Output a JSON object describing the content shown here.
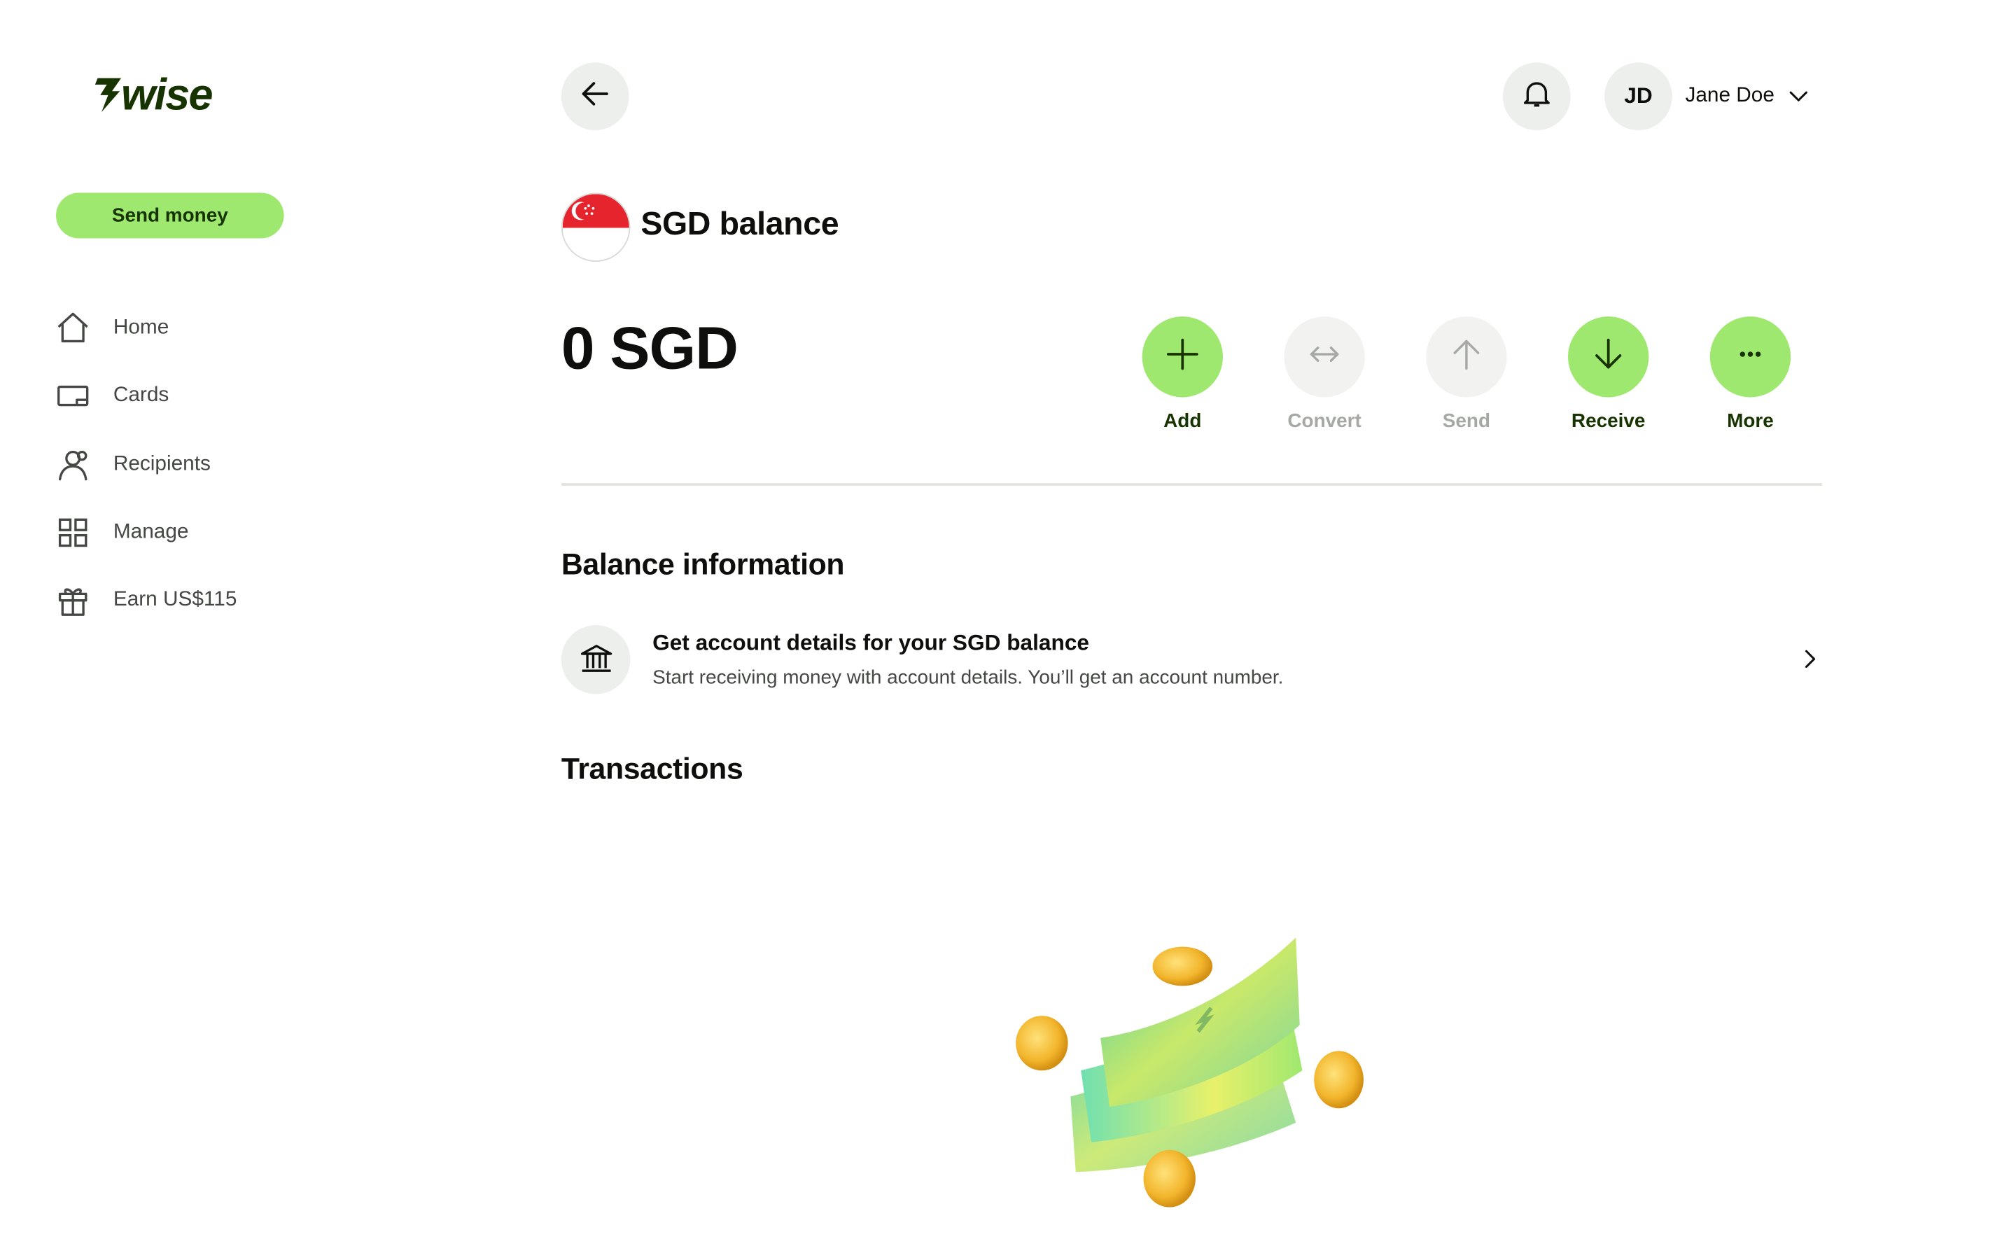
{
  "brand": {
    "name": "wise",
    "accent": "#9fe870",
    "accent_text": "#163300"
  },
  "sidebar": {
    "send_money_label": "Send money",
    "items": [
      {
        "label": "Home",
        "icon": "home-icon"
      },
      {
        "label": "Cards",
        "icon": "card-icon"
      },
      {
        "label": "Recipients",
        "icon": "recipients-icon"
      },
      {
        "label": "Manage",
        "icon": "grid-icon"
      },
      {
        "label": "Earn US$115",
        "icon": "gift-icon"
      }
    ]
  },
  "header": {
    "back_icon": "arrow-left-icon",
    "notifications_icon": "bell-icon",
    "user": {
      "initials": "JD",
      "name": "Jane Doe",
      "menu_icon": "chevron-down-icon"
    }
  },
  "balance": {
    "flag": "singapore-flag",
    "title": "SGD balance",
    "amount": "0 SGD"
  },
  "actions": [
    {
      "label": "Add",
      "icon": "plus-icon",
      "enabled": true
    },
    {
      "label": "Convert",
      "icon": "convert-icon",
      "enabled": false
    },
    {
      "label": "Send",
      "icon": "arrow-up-icon",
      "enabled": false
    },
    {
      "label": "Receive",
      "icon": "arrow-down-icon",
      "enabled": true
    },
    {
      "label": "More",
      "icon": "more-icon",
      "enabled": true
    }
  ],
  "balance_info": {
    "section_title": "Balance information",
    "account_details": {
      "icon": "bank-icon",
      "heading": "Get account details for your SGD balance",
      "subtext": "Start receiving money with account details. You’ll get an account number."
    }
  },
  "transactions": {
    "section_title": "Transactions",
    "empty_illustration": "money-illustration"
  }
}
